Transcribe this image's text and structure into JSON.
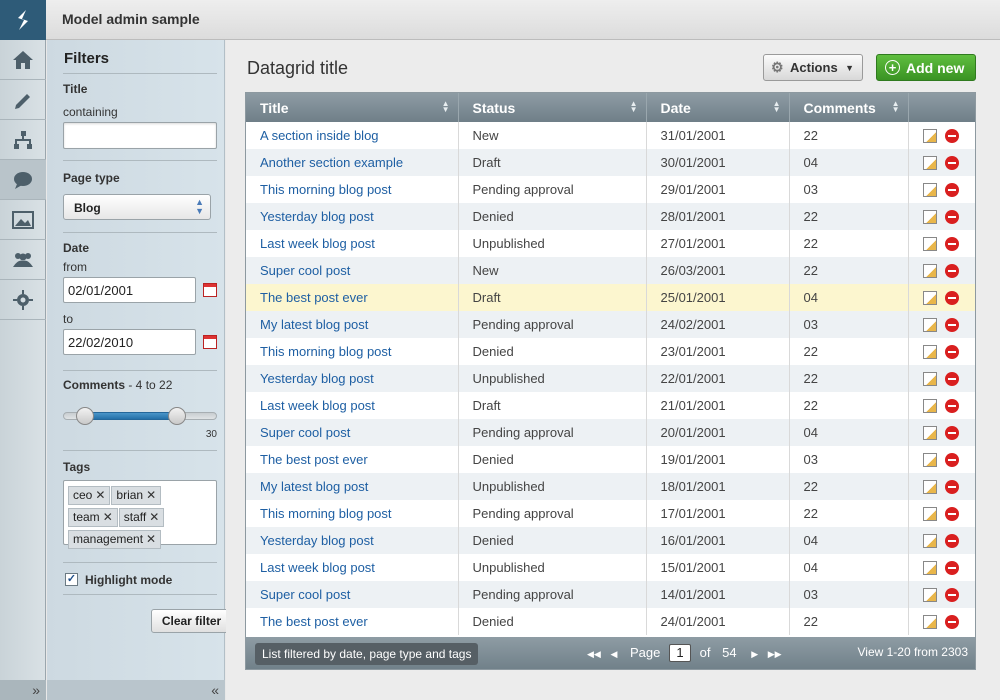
{
  "app": {
    "title": "Model admin sample"
  },
  "nav": {
    "items": [
      "home-icon",
      "pencil-icon",
      "sitemap-icon",
      "comment-icon",
      "image-icon",
      "users-icon",
      "gear-icon"
    ],
    "expand_label": "»"
  },
  "filters": {
    "heading": "Filters",
    "title": {
      "label": "Title",
      "sub": "containing",
      "value": ""
    },
    "page_type": {
      "label": "Page type",
      "selected": "Blog"
    },
    "date": {
      "label": "Date",
      "from_label": "from",
      "from_value": "02/01/2001",
      "to_label": "to",
      "to_value": "22/02/2010"
    },
    "comments": {
      "label": "Comments",
      "range_text": " - 4 to 22",
      "max": "30",
      "min_value": 4,
      "max_value": 22,
      "scale_max": 30
    },
    "tags": {
      "label": "Tags",
      "items": [
        "ceo",
        "brian",
        "team",
        "staff",
        "management"
      ]
    },
    "highlight": {
      "label": "Highlight mode",
      "checked": true
    },
    "clear_label": "Clear filter",
    "collapse_label": "«"
  },
  "grid": {
    "title": "Datagrid title",
    "actions_label": "Actions",
    "add_label": "Add new",
    "columns": [
      "Title",
      "Status",
      "Date",
      "Comments"
    ],
    "rows": [
      {
        "title": "A section inside blog",
        "status": "New",
        "date": "31/01/2001",
        "comments": "22"
      },
      {
        "title": "Another section example",
        "status": "Draft",
        "date": "30/01/2001",
        "comments": "04"
      },
      {
        "title": "This morning blog post",
        "status": "Pending approval",
        "date": "29/01/2001",
        "comments": "03"
      },
      {
        "title": "Yesterday blog post",
        "status": "Denied",
        "date": "28/01/2001",
        "comments": "22"
      },
      {
        "title": "Last week blog post",
        "status": "Unpublished",
        "date": "27/01/2001",
        "comments": "22"
      },
      {
        "title": "Super cool post",
        "status": "New",
        "date": "26/03/2001",
        "comments": "22"
      },
      {
        "title": "The best post ever",
        "status": "Draft",
        "date": "25/01/2001",
        "comments": "04",
        "highlight": true
      },
      {
        "title": "My latest blog post",
        "status": "Pending approval",
        "date": "24/02/2001",
        "comments": "03"
      },
      {
        "title": "This morning blog post",
        "status": "Denied",
        "date": "23/01/2001",
        "comments": "22"
      },
      {
        "title": "Yesterday blog post",
        "status": "Unpublished",
        "date": "22/01/2001",
        "comments": "22"
      },
      {
        "title": "Last week blog post",
        "status": "Draft",
        "date": "21/01/2001",
        "comments": "22"
      },
      {
        "title": "Super cool post",
        "status": "Pending approval",
        "date": "20/01/2001",
        "comments": "04"
      },
      {
        "title": "The best post ever",
        "status": "Denied",
        "date": "19/01/2001",
        "comments": "03"
      },
      {
        "title": "My latest blog post",
        "status": "Unpublished",
        "date": "18/01/2001",
        "comments": "22"
      },
      {
        "title": "This morning blog post",
        "status": "Pending approval",
        "date": "17/01/2001",
        "comments": "22"
      },
      {
        "title": "Yesterday blog post",
        "status": "Denied",
        "date": "16/01/2001",
        "comments": "04"
      },
      {
        "title": "Last week blog post",
        "status": "Unpublished",
        "date": "15/01/2001",
        "comments": "04"
      },
      {
        "title": "Super cool post",
        "status": "Pending approval",
        "date": "14/01/2001",
        "comments": "03"
      },
      {
        "title": "The best post ever",
        "status": "Denied",
        "date": "24/01/2001",
        "comments": "22"
      }
    ],
    "footer": {
      "filtered_text": "List filtered by date, page type and tags",
      "page_label": "Page",
      "page_value": "1",
      "of_label": "of",
      "total_pages": "54",
      "view_text": "View 1-20 from 2303"
    }
  },
  "colors": {
    "accent_green": "#3a9323",
    "link": "#1e5fa3",
    "highlight_row": "#fcf6cf",
    "delete": "#d91f1f"
  }
}
